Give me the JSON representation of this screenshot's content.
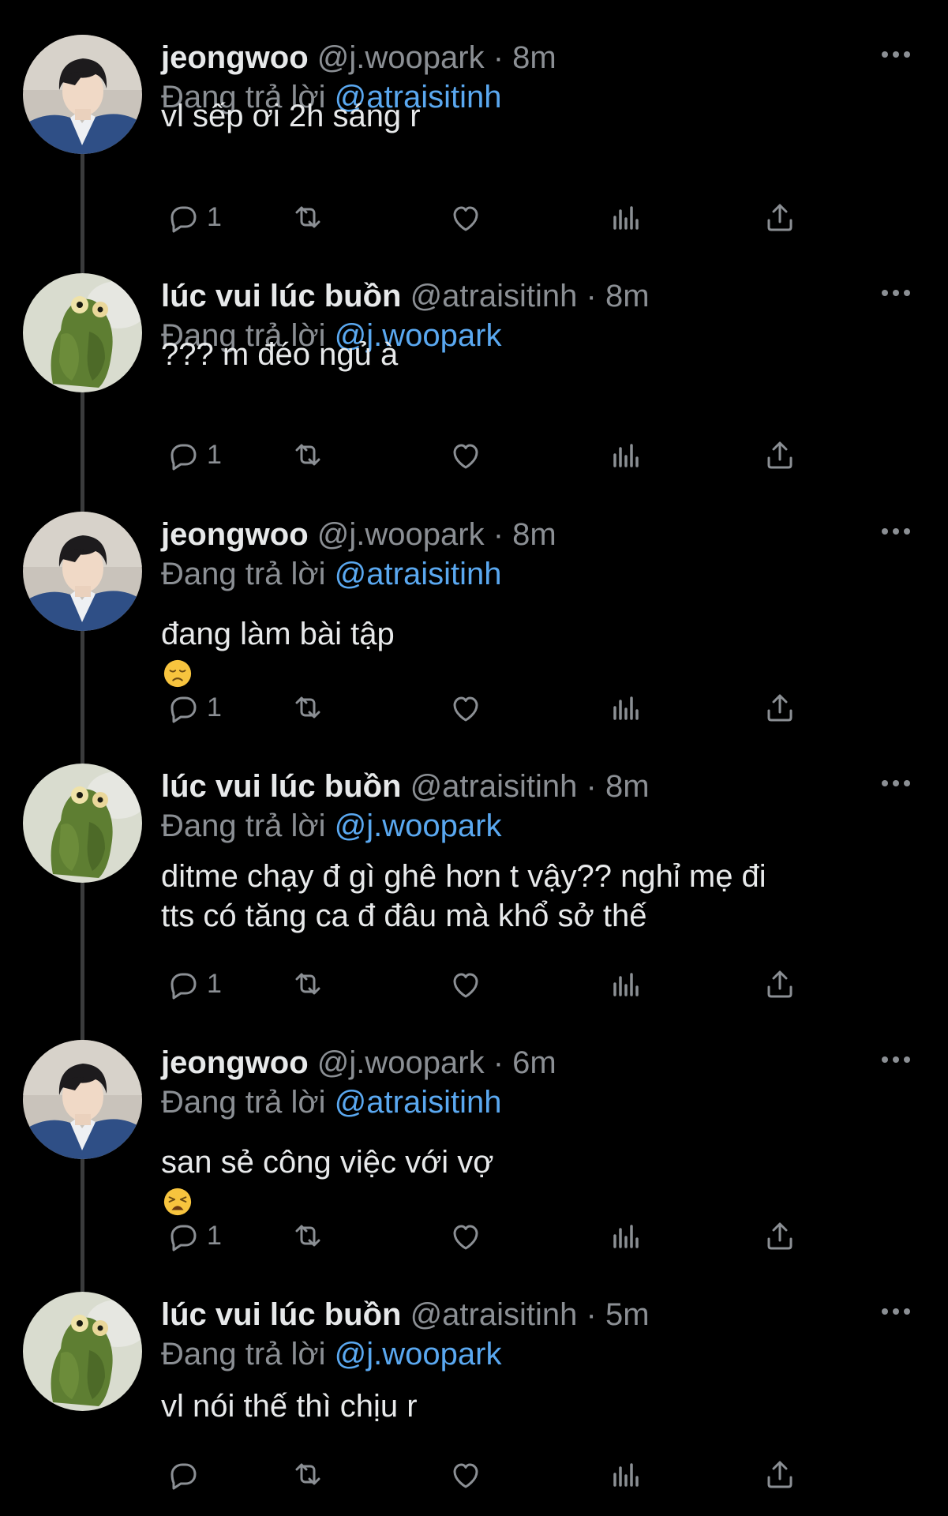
{
  "ui": {
    "reply_prefix": "Đang trả lời",
    "dot": "·"
  },
  "tweets": [
    {
      "name": "jeongwoo",
      "handle": "@j.woopark",
      "time": "8m",
      "reply_to": "@atraisitinh",
      "text": "vl sếp ơi 2h sáng r",
      "emoji": "",
      "reply_count": "1",
      "avatar": "person-avatar"
    },
    {
      "name": "lúc vui lúc buồn",
      "handle": "@atraisitinh",
      "time": "8m",
      "reply_to": "@j.woopark",
      "text": "??? m đéo ngủ à",
      "emoji": "",
      "reply_count": "1",
      "avatar": "frog-avatar"
    },
    {
      "name": "jeongwoo",
      "handle": "@j.woopark",
      "time": "8m",
      "reply_to": "@atraisitinh",
      "text": "đang làm bài tập",
      "emoji": "disappointed-face-emoji",
      "reply_count": "1",
      "avatar": "person-avatar"
    },
    {
      "name": "lúc vui lúc buồn",
      "handle": "@atraisitinh",
      "time": "8m",
      "reply_to": "@j.woopark",
      "text": "ditme chạy đ gì ghê hơn t vậy?? nghỉ mẹ đi\ntts có tăng ca đ đâu mà khổ sở thế",
      "emoji": "",
      "reply_count": "1",
      "avatar": "frog-avatar"
    },
    {
      "name": "jeongwoo",
      "handle": "@j.woopark",
      "time": "6m",
      "reply_to": "@atraisitinh",
      "text": "san sẻ công việc với vợ",
      "emoji": "weary-face-emoji",
      "reply_count": "1",
      "avatar": "person-avatar"
    },
    {
      "name": "lúc vui lúc buồn",
      "handle": "@atraisitinh",
      "time": "5m",
      "reply_to": "@j.woopark",
      "text": "vl nói thế thì chịu r",
      "emoji": "",
      "reply_count": "",
      "avatar": "frog-avatar"
    }
  ],
  "colors": {
    "background": "#000000",
    "text": "#e7e9ea",
    "secondary": "#8b8f94",
    "mention": "#5aa8f0",
    "thread_line": "#3a3b3c"
  }
}
